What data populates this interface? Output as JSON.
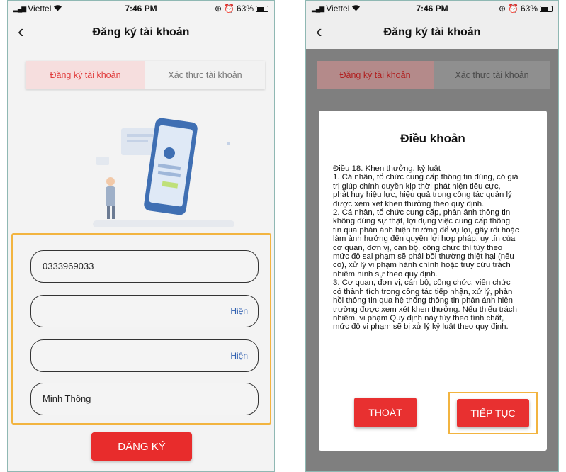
{
  "status_bar": {
    "carrier": "Viettel",
    "time": "7:46 PM",
    "battery": "63%"
  },
  "register_screen": {
    "nav_title": "Đăng ký tài khoản",
    "tabs": [
      {
        "label": "Đăng ký tài khoản",
        "active": true
      },
      {
        "label": "Xác thực tài khoản",
        "active": false
      }
    ],
    "fields": [
      {
        "value": "0333969033",
        "toggle": ""
      },
      {
        "value": "",
        "toggle": "Hiện"
      },
      {
        "value": "",
        "toggle": "Hiện"
      },
      {
        "value": "Minh Thông",
        "toggle": ""
      }
    ],
    "submit_label": "ĐĂNG KÝ"
  },
  "terms_screen": {
    "nav_title": "Đăng ký tài khoản",
    "tabs": [
      {
        "label": "Đăng ký tài khoản",
        "active": true
      },
      {
        "label": "Xác thực tài khoản",
        "active": false
      }
    ],
    "modal": {
      "title": "Điều khoản",
      "lines": [
        "Điều 18. Khen thưởng, kỷ luật",
        "1. Cá nhân, tổ chức cung cấp thông tin đúng, có giá",
        "trị giúp chính quyền kịp thời phát hiện tiêu cực,",
        "phát huy hiệu lực, hiệu quả trong công tác quản lý",
        "được xem xét khen thưởng theo quy định.",
        "2. Cá nhân, tổ chức cung cấp, phản ánh thông tin",
        "không đúng sự thật, lợi dụng việc cung cấp thông",
        "tin qua phản ánh hiện trường để vụ lợi, gây rối hoặc",
        "làm ảnh hưởng đến quyền lợi hợp pháp, uy tín của",
        "cơ quan, đơn vị, cán bộ, công chức thì tùy theo",
        "mức độ sai phạm sẽ phải bồi thường thiệt hại (nếu",
        "có), xử lý vi phạm hành chính hoặc truy cứu trách",
        "nhiệm hình sự theo quy định.",
        "3. Cơ quan, đơn vị, cán bộ, công chức, viên chức",
        "có thành tích trong công tác tiếp nhận, xử lý, phản",
        "hồi thông tin qua hệ thống thông tin phản ánh hiện",
        "trường được xem xét khen thưởng. Nếu thiếu trách",
        "nhiệm, vi phạm Quy định này tùy theo tính chất,",
        "mức độ vi phạm sẽ bị xử lý kỷ luật theo quy định."
      ],
      "exit_label": "THOÁT",
      "continue_label": "TIẾP TỤC"
    }
  },
  "colors": {
    "accent_red": "#e82c2c",
    "tab_active_bg": "#f6dede",
    "highlight_border": "#f2b440",
    "link_blue": "#2f5fb0"
  }
}
